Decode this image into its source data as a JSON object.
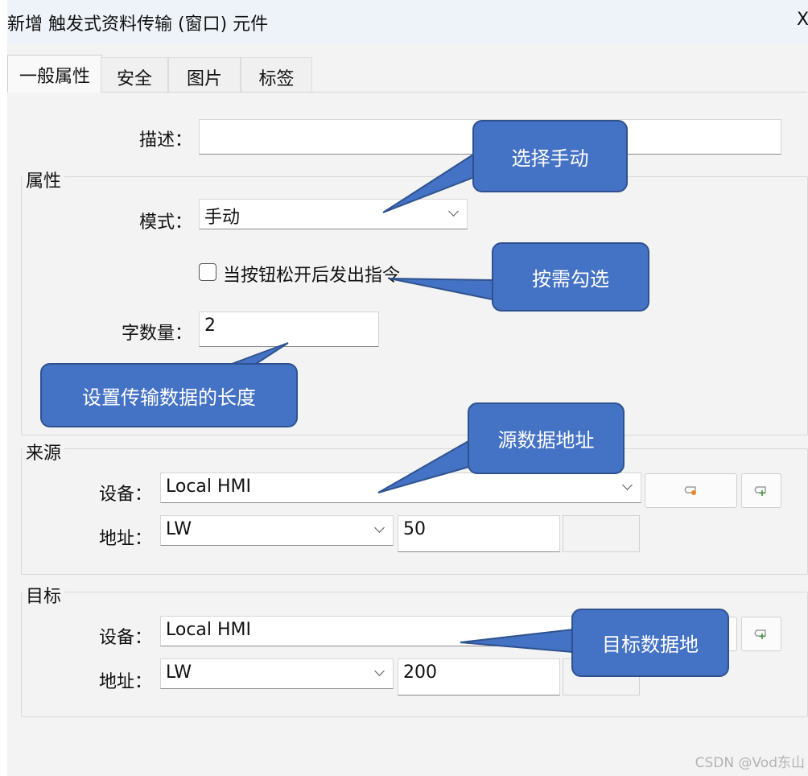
{
  "window": {
    "title": "新增 触发式资料传输 (窗口) 元件",
    "close_glyph": "X"
  },
  "tabs": [
    {
      "label": "一般属性",
      "active": true
    },
    {
      "label": "安全",
      "active": false
    },
    {
      "label": "图片",
      "active": false
    },
    {
      "label": "标签",
      "active": false
    }
  ],
  "general": {
    "description_label": "描述：",
    "description_value": ""
  },
  "attributes": {
    "group_label": "属性",
    "mode_label": "模式：",
    "mode_value": "手动",
    "checkbox_label": "当按钮松开后发出指令",
    "checkbox_checked": false,
    "word_count_label": "字数量：",
    "word_count_value": "2"
  },
  "source": {
    "group_label": "来源",
    "device_label": "设备：",
    "device_value": "Local HMI",
    "address_label": "地址：",
    "address_type": "LW",
    "address_value": "50"
  },
  "target": {
    "group_label": "目标",
    "device_label": "设备：",
    "device_value": "Local HMI",
    "address_label": "地址：",
    "address_type": "LW",
    "address_value": "200"
  },
  "callouts": {
    "select_manual": "选择手动",
    "check_as_needed": "按需勾选",
    "set_length": "设置传输数据的长度",
    "source_address": "源数据地址",
    "target_address": "目标数据地"
  },
  "watermark": "CSDN @Vod东山",
  "colors": {
    "callout_fill": "#4472c4",
    "callout_border": "#2f528f",
    "title_bar": "#eef3fa",
    "dialog_bg": "#f3f3f3"
  },
  "icons": [
    "device-settings-icon",
    "device-add-icon",
    "chevron-down-icon",
    "close-icon"
  ]
}
